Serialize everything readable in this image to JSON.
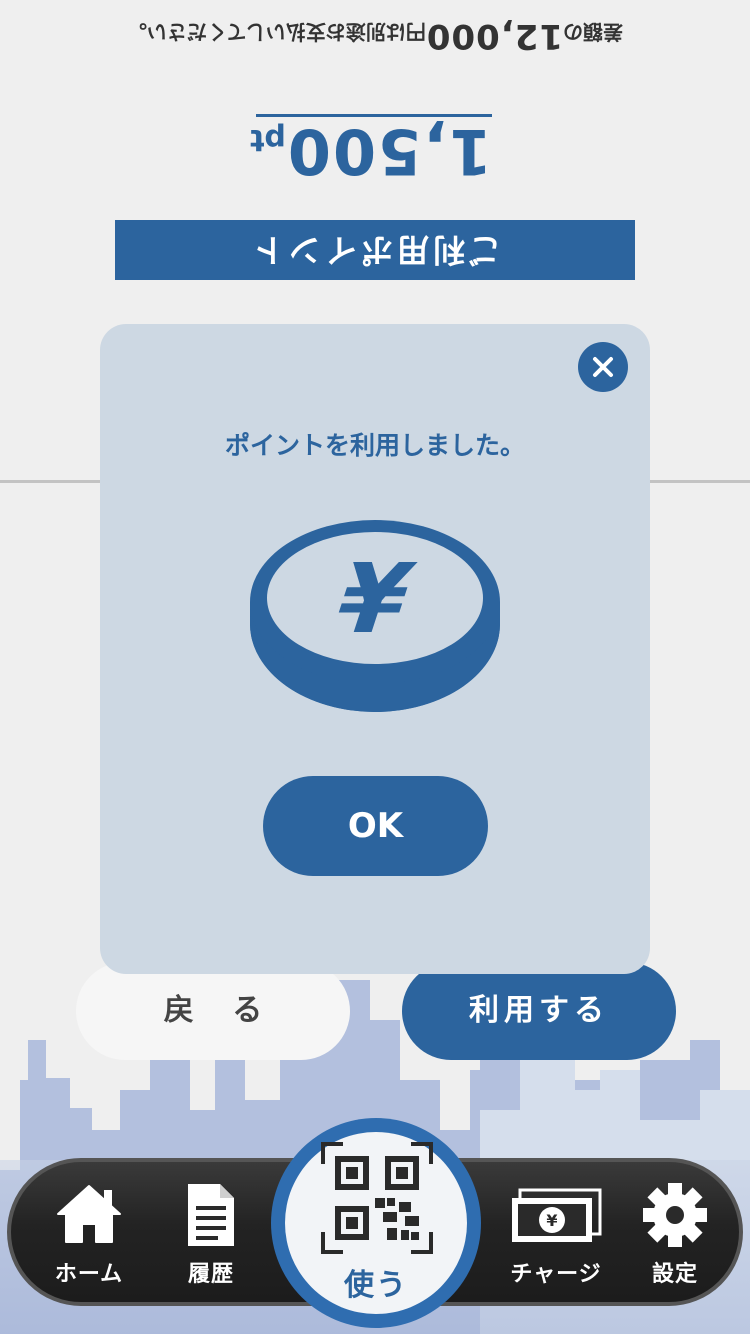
{
  "header": {
    "note_prefix": "差額の",
    "note_amount": "12,000",
    "note_suffix": "円は別途お支払いしてください。",
    "points_value": "1,500",
    "points_unit": "pt",
    "label": "ご利用ポイント"
  },
  "actions": {
    "back_label": "戻 る",
    "use_label": "利用する"
  },
  "modal": {
    "message": "ポイントを利用しました。",
    "ok_label": "OK",
    "coin_symbol": "¥"
  },
  "tabbar": {
    "home": "ホーム",
    "history": "履歴",
    "use": "使う",
    "charge": "チャージ",
    "settings": "設定"
  },
  "colors": {
    "primary": "#2c649e",
    "modal_bg": "#cdd8e3",
    "page_bg": "#efefef",
    "tabbar_bg": "#232323"
  },
  "icons": [
    "close-icon",
    "coin-yen-icon",
    "home-icon",
    "document-icon",
    "qr-code-icon",
    "banknote-yen-icon",
    "gear-icon"
  ]
}
